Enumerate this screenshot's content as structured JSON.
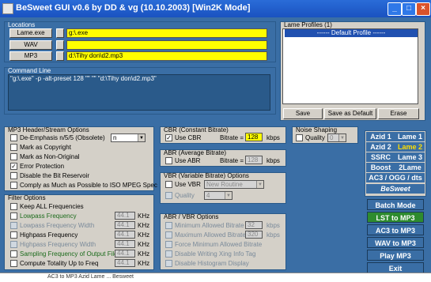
{
  "window": {
    "title": "BeSweet GUI v0.6   by DD & vg (10.10.2003)  [Win2K Mode]"
  },
  "locations": {
    "title": "Locations",
    "rows": [
      {
        "label": "Lame.exe",
        "value": "g:\\.exe"
      },
      {
        "label": "WAV",
        "value": ""
      },
      {
        "label": "MP3",
        "value": "d:\\Tihy don\\d2.mp3"
      }
    ]
  },
  "command_line": {
    "title": "Command Line",
    "text": "\"g:\\.exe\" -p -alt-preset 128 \"\" \"\" \"d:\\Tihy don\\d2.mp3\""
  },
  "lame_profiles": {
    "title": "Lame Profiles (1)",
    "items": [
      "------ Default Profile ------"
    ],
    "buttons": [
      "Save",
      "Save as Default",
      "Erase"
    ]
  },
  "mp3_header": {
    "title": "MP3 Header/Stream Options",
    "items": [
      {
        "label": "De-Emphasis n/5/5 (Obsolete)",
        "checked": false
      },
      {
        "label": "Mark as Copyright",
        "checked": false
      },
      {
        "label": "Mark as Non-Original",
        "checked": false
      },
      {
        "label": "Error Protection",
        "checked": true
      },
      {
        "label": "Disable the Bit Reservoir",
        "checked": false
      },
      {
        "label": "Comply as Much as Possible to ISO MPEG Spec",
        "checked": false
      }
    ],
    "deemphasis_value": "n"
  },
  "filter_options": {
    "title": "Filter Options",
    "items": [
      {
        "label": "Keep ALL Frequencies",
        "value": "",
        "unit": ""
      },
      {
        "label": "Lowpass Frequency",
        "value": "44.1",
        "unit": "KHz"
      },
      {
        "label": "Lowpass Frequency Width",
        "value": "44.1",
        "unit": "KHz"
      },
      {
        "label": "Highpass Frequency",
        "value": "44.1",
        "unit": "KHz"
      },
      {
        "label": "Highpass Frequency Width",
        "value": "44.1",
        "unit": "KHz"
      },
      {
        "label": "Sampling Frequency of Output File",
        "value": "44.1",
        "unit": "KHz"
      },
      {
        "label": "Compute Totality Up to Freq",
        "value": "44.1",
        "unit": "KHz"
      }
    ]
  },
  "cbr": {
    "title": "CBR (Constant Bitrate)",
    "use_label": "Use CBR",
    "bitrate_label": "Bitrate =",
    "bitrate": "128",
    "unit": "kbps"
  },
  "abr": {
    "title": "ABR (Average Bitrate)",
    "use_label": "Use ABR",
    "bitrate_label": "Bitrate =",
    "bitrate": "128",
    "unit": "kbps"
  },
  "vbr": {
    "title": "VBR (Variable Bitrate) Options",
    "use_label": "Use VBR",
    "routine": "New Routine",
    "quality_label": "Quality",
    "quality": "4"
  },
  "abr_vbr": {
    "title": "ABR / VBR Options",
    "min_label": "Minimum Allowed Bitrate",
    "min_value": "32",
    "max_label": "Maximum Allowed Bitrate",
    "max_value": "320",
    "unit": "kbps",
    "opts": [
      "Force Minimum Allowed Bitrate",
      "Disable Writing Xing Info Tag",
      "Disable Histogram Display"
    ]
  },
  "noise_shaping": {
    "title": "Noise Shaping",
    "quality_label": "Quality",
    "quality": "0"
  },
  "presets": {
    "rows": [
      [
        "Azid 1",
        "Lame 1"
      ],
      [
        "Azid 2",
        "Lame 2"
      ],
      [
        "SSRC",
        "Lame 3"
      ],
      [
        "Boost",
        "2Lame"
      ]
    ],
    "codecs": "AC3 / OGG / dts",
    "brand": "BeSweet"
  },
  "actions": [
    "Batch Mode",
    "LST to MP3",
    "AC3 to MP3",
    "WAV to MP3",
    "Play MP3",
    "Exit"
  ],
  "action_colors": [
    "#3a6ea5",
    "#2e8b2e",
    "#3a6ea5",
    "#3a6ea5",
    "#3a6ea5",
    "#3a6ea5"
  ],
  "taskbar": {
    "text": "AC3 to MP3    Azid  Lame ...   Besweet"
  }
}
